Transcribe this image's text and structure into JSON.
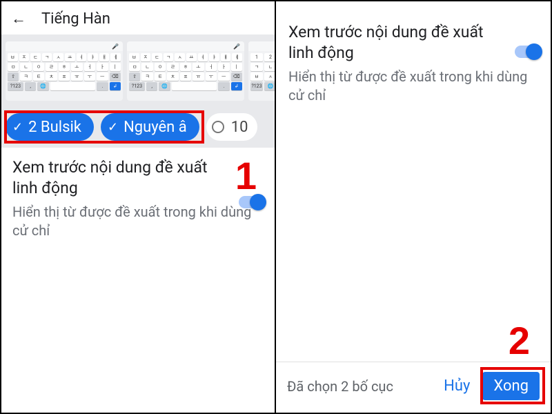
{
  "left": {
    "title": "Tiếng Hàn",
    "chips": {
      "selected": [
        {
          "label": "2 Bulsik"
        },
        {
          "label": "Nguyên â"
        }
      ],
      "unselected_label": "10"
    },
    "setting": {
      "title": "Xem trước nội dung đề xuất linh động",
      "subtitle": "Hiển thị từ được đề xuất trong khi dùng cử chỉ",
      "enabled": true
    },
    "keyboard_previews": {
      "bottom_left_label": "?123",
      "enter_glyph": "↲"
    }
  },
  "right": {
    "setting": {
      "title": "Xem trước nội dung đề xuất linh động",
      "subtitle": "Hiển thị từ được đề xuất trong khi dùng cử chỉ",
      "enabled": true
    },
    "footer": {
      "status": "Đã chọn 2 bố cục",
      "cancel": "Hủy",
      "done": "Xong"
    }
  },
  "annotations": {
    "step1": "1",
    "step2": "2"
  },
  "colors": {
    "accent": "#1a73e8",
    "highlight": "#e60000"
  }
}
